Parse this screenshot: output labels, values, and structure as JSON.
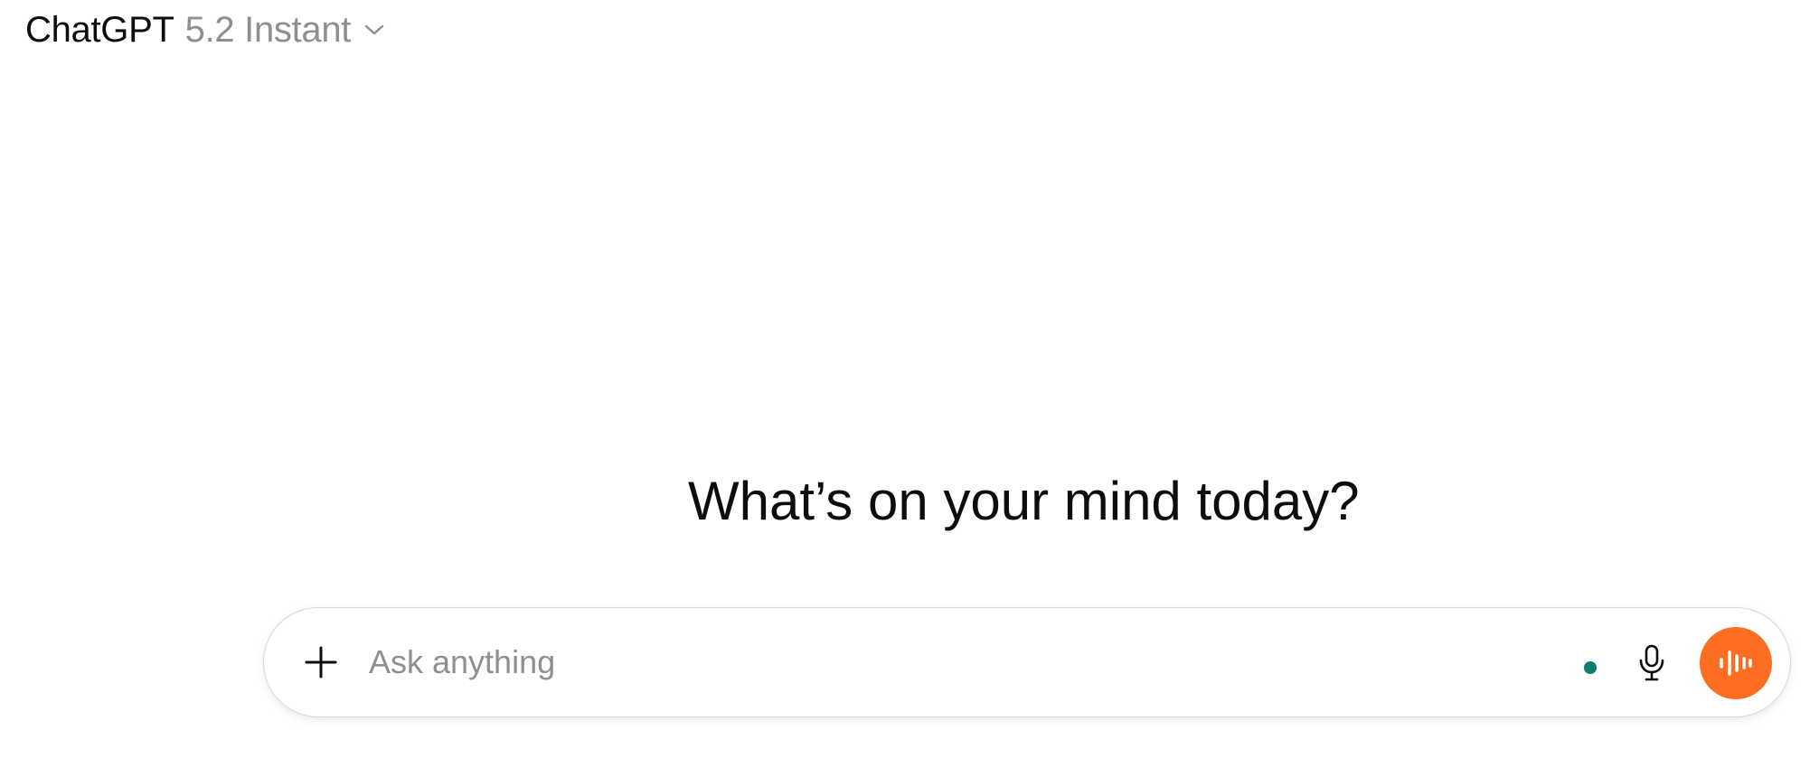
{
  "header": {
    "model_name": "ChatGPT",
    "model_version": "5.2 Instant",
    "chevron_icon": "chevron-down-icon"
  },
  "main": {
    "headline": "What’s on your mind today?"
  },
  "composer": {
    "placeholder": "Ask anything",
    "value": "",
    "add_icon": "plus-icon",
    "mic_icon": "microphone-icon",
    "voice_icon": "voice-waveform-icon"
  },
  "colors": {
    "accent_voice": "#fd6d22",
    "status_dot": "#0e7c6b",
    "muted_text": "#8f8f8f"
  }
}
